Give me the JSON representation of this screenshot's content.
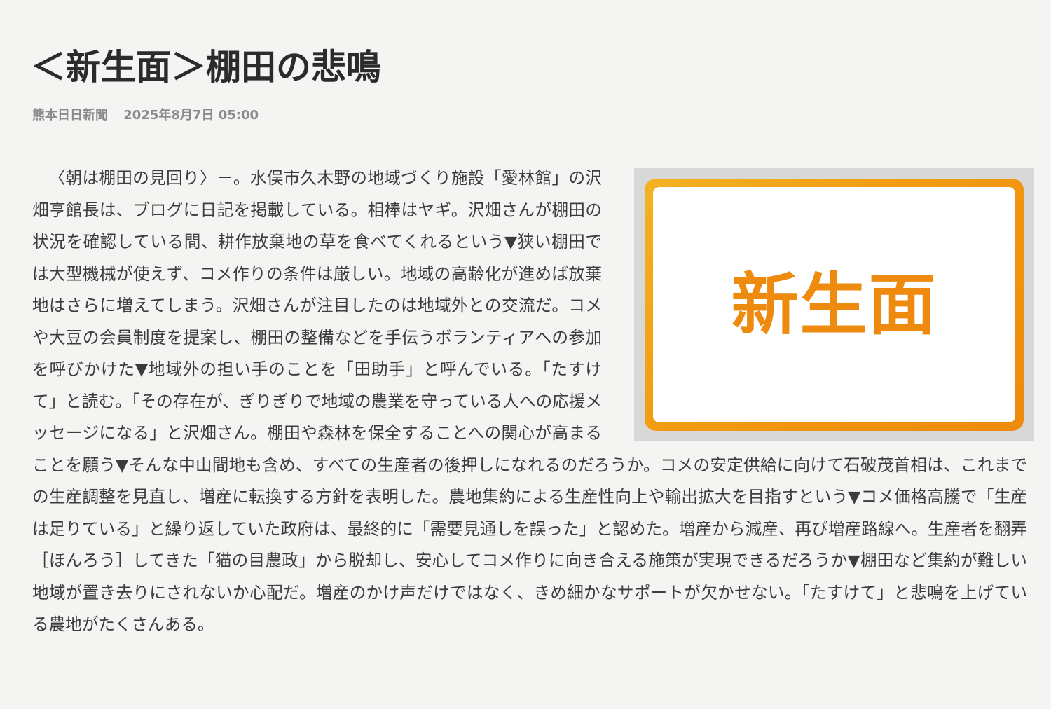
{
  "article": {
    "headline": "＜新生面＞棚田の悲鳴",
    "source": "熊本日日新聞",
    "date": "2025年8月7日 05:00",
    "image": {
      "label": "新生面",
      "accent_color": "#ee8a0d",
      "frame_color": "#d8d8d8"
    },
    "body": "〈朝は棚田の見回り〉－。水俣市久木野の地域づくり施設「愛林館」の沢畑亨館長は、ブログに日記を掲載している。相棒はヤギ。沢畑さんが棚田の状況を確認している間、耕作放棄地の草を食べてくれるという▼狭い棚田では大型機械が使えず、コメ作りの条件は厳しい。地域の高齢化が進めば放棄地はさらに増えてしまう。沢畑さんが注目したのは地域外との交流だ。コメや大豆の会員制度を提案し、棚田の整備などを手伝うボランティアへの参加を呼びかけた▼地域外の担い手のことを「田助手」と呼んでいる。「たすけて」と読む。「その存在が、ぎりぎりで地域の農業を守っている人への応援メッセージになる」と沢畑さん。棚田や森林を保全することへの関心が高まることを願う▼そんな中山間地も含め、すべての生産者の後押しになれるのだろうか。コメの安定供給に向けて石破茂首相は、これまでの生産調整を見直し、増産に転換する方針を表明した。農地集約による生産性向上や輸出拡大を目指すという▼コメ価格高騰で「生産は足りている」と繰り返していた政府は、最終的に「需要見通しを誤った」と認めた。増産から減産、再び増産路線へ。生産者を翻弄［ほんろう］してきた「猫の目農政」から脱却し、安心してコメ作りに向き合える施策が実現できるだろうか▼棚田など集約が難しい地域が置き去りにされないか心配だ。増産のかけ声だけではなく、きめ細かなサポートが欠かせない。「たすけて」と悲鳴を上げている農地がたくさんある。"
  }
}
